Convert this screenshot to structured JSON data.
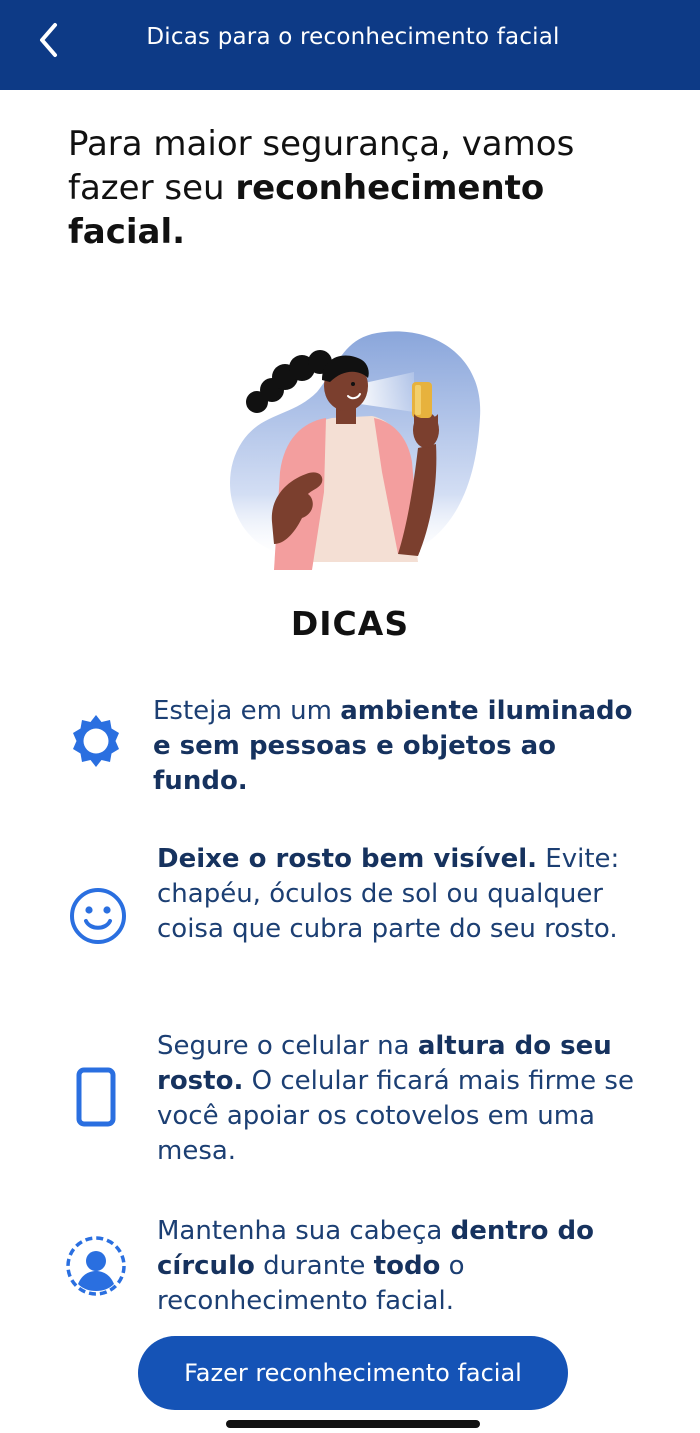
{
  "header": {
    "title": "Dicas para o reconhecimento facial",
    "back_icon": "chevron-left-icon"
  },
  "headline": {
    "part1": "Para maior segurança, vamos fazer seu ",
    "bold": "reconhecimento facial."
  },
  "section_title": "DICAS",
  "tips": [
    {
      "icon": "sun-icon",
      "t1": "Esteja em um ",
      "b1": "ambiente iluminado e sem pessoas e objetos ao fundo.",
      "t2": "",
      "b2": "",
      "t3": ""
    },
    {
      "icon": "smiley-icon",
      "t1": "",
      "b1": "Deixe o rosto bem visível.",
      "t2": " Evite: chapéu, óculos de sol ou qualquer coisa que cubra parte do seu rosto.",
      "b2": "",
      "t3": ""
    },
    {
      "icon": "smartphone-icon",
      "t1": "Segure o celular na ",
      "b1": "altura do seu rosto.",
      "t2": " O celular ficará mais firme se você apoiar os cotovelos em uma mesa.",
      "b2": "",
      "t3": ""
    },
    {
      "icon": "face-circle-icon",
      "t1": "Mantenha sua cabeça ",
      "b1": "dentro do círculo",
      "t2": " durante ",
      "b2": "todo",
      "t3": " o reconhecimento facial."
    }
  ],
  "cta_label": "Fazer reconhecimento facial",
  "colors": {
    "header_bg": "#0d3a86",
    "accent": "#1553b6",
    "icon": "#2a6fe0",
    "tip_text": "#1c3f73"
  }
}
